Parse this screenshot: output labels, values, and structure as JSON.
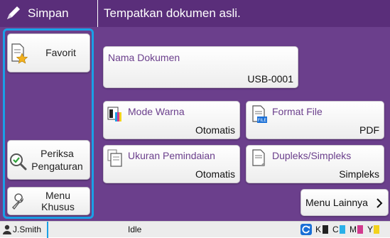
{
  "header": {
    "title": "Simpan",
    "message": "Tempatkan dokumen asli."
  },
  "sidebar": {
    "favorite_label": "Favorit",
    "check_settings_label": "Periksa Pengaturan",
    "custom_menu_label": "Menu Khusus"
  },
  "document_name": {
    "label": "Nama Dokumen",
    "value": "USB-0001"
  },
  "settings": {
    "color_mode": {
      "label": "Mode Warna",
      "value": "Otomatis"
    },
    "file_format": {
      "label": "Format File",
      "value": "PDF"
    },
    "scan_size": {
      "label": "Ukuran Pemindaian",
      "value": "Otomatis"
    },
    "duplex": {
      "label": "Dupleks/Simpleks",
      "value": "Simpleks"
    }
  },
  "more_menu_label": "Menu Lainnya",
  "status_bar": {
    "user": "J.Smith",
    "state": "Idle",
    "toner": [
      "K",
      "C",
      "M",
      "Y"
    ]
  },
  "colors": {
    "header": "#5a2e7a",
    "panel": "#6b3f8c",
    "selection": "#1aa0e6",
    "label_text": "#6b3f8c"
  }
}
